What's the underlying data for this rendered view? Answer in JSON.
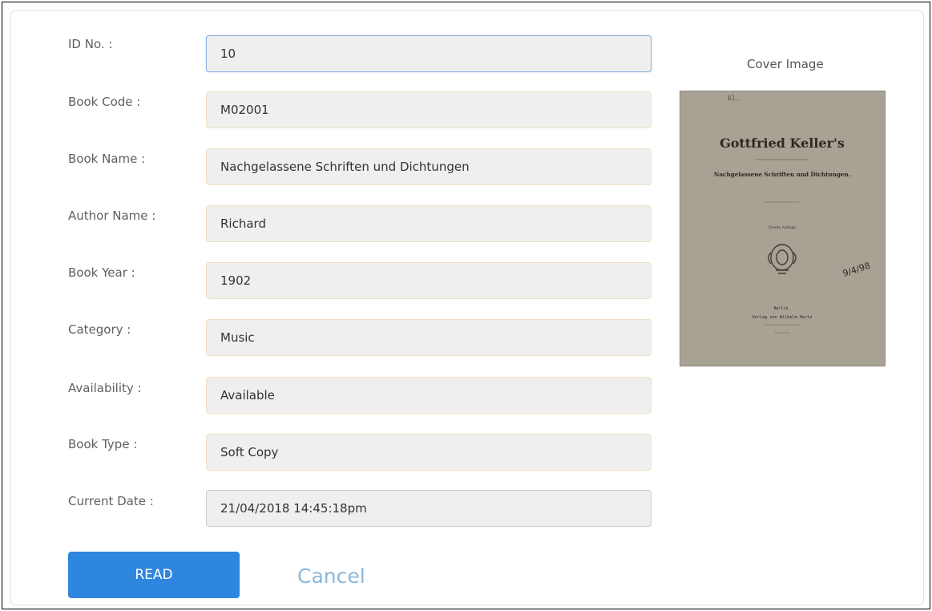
{
  "form": {
    "fields": [
      {
        "label": "ID No. :",
        "value": "10"
      },
      {
        "label": "Book Code :",
        "value": "M02001"
      },
      {
        "label": "Book Name :",
        "value": "Nachgelassene Schriften und Dichtungen"
      },
      {
        "label": "Author Name :",
        "value": "Richard"
      },
      {
        "label": "Book Year :",
        "value": "1902"
      },
      {
        "label": "Category :",
        "value": "Music"
      },
      {
        "label": "Availability :",
        "value": "Available"
      },
      {
        "label": "Book Type :",
        "value": "Soft Copy"
      },
      {
        "label": "Current Date :",
        "value": "21/04/2018 14:45:18pm"
      }
    ]
  },
  "cover": {
    "label": "Cover Image",
    "title_line": "Gottfried Keller's",
    "subtitle_line": "Nachgelassene Schriften und Dichtungen.",
    "edition_line": "Zweite Auflage",
    "publisher_line1": "Berlin.",
    "publisher_line2": "Verlag von Wilhelm Hertz",
    "handwritten": "9/4/98"
  },
  "actions": {
    "read_label": "READ",
    "cancel_label": "Cancel"
  },
  "colors": {
    "primary": "#2f86de",
    "cancel_link": "#8ab8db",
    "field_bg": "#efefef",
    "field_border": "#f0dfc6"
  }
}
